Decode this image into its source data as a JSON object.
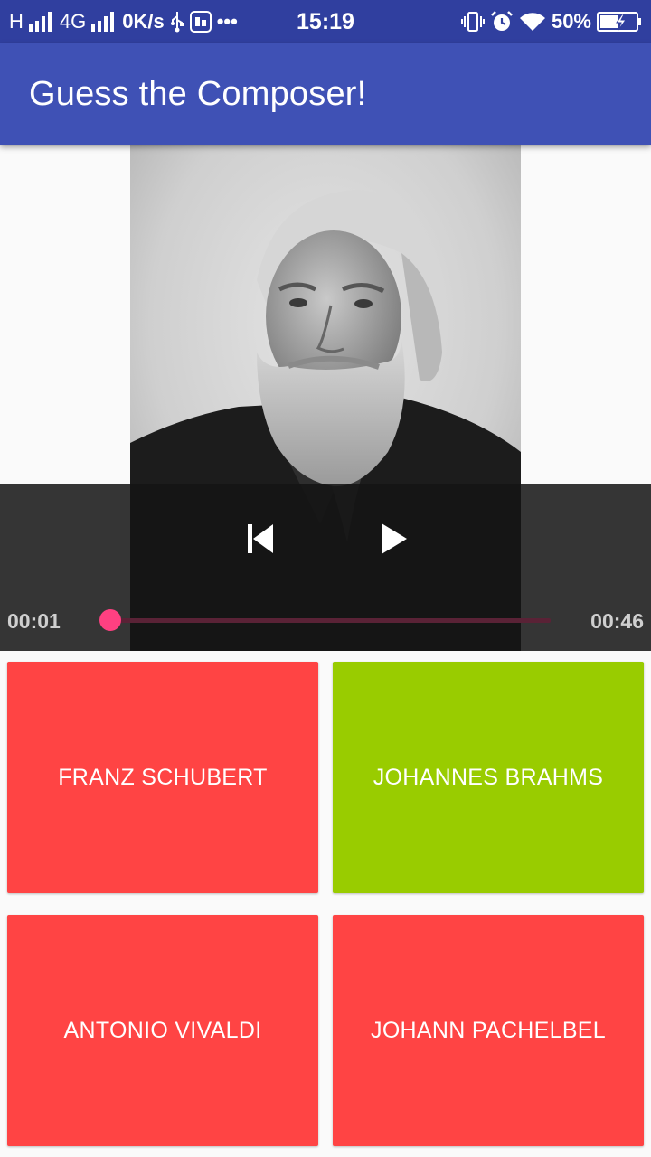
{
  "status_bar": {
    "network_type": "H",
    "network_4g": "4G",
    "speed": "0K/s",
    "more": "•••",
    "time": "15:19",
    "battery": "50%"
  },
  "app_bar": {
    "title": "Guess the Composer!"
  },
  "media": {
    "current_time": "00:01",
    "total_time": "00:46",
    "progress_fraction": 0.02,
    "accent_color": "#ff4081"
  },
  "answers": [
    {
      "label": "FRANZ SCHUBERT",
      "color": "#ff4444"
    },
    {
      "label": "JOHANNES BRAHMS",
      "color": "#99cc00"
    },
    {
      "label": "ANTONIO VIVALDI",
      "color": "#ff4444"
    },
    {
      "label": "JOHANN PACHELBEL",
      "color": "#ff4444"
    }
  ],
  "colors": {
    "status_bar": "#303f9f",
    "app_bar": "#3f51b5",
    "wrong": "#ff4444",
    "correct": "#99cc00"
  }
}
